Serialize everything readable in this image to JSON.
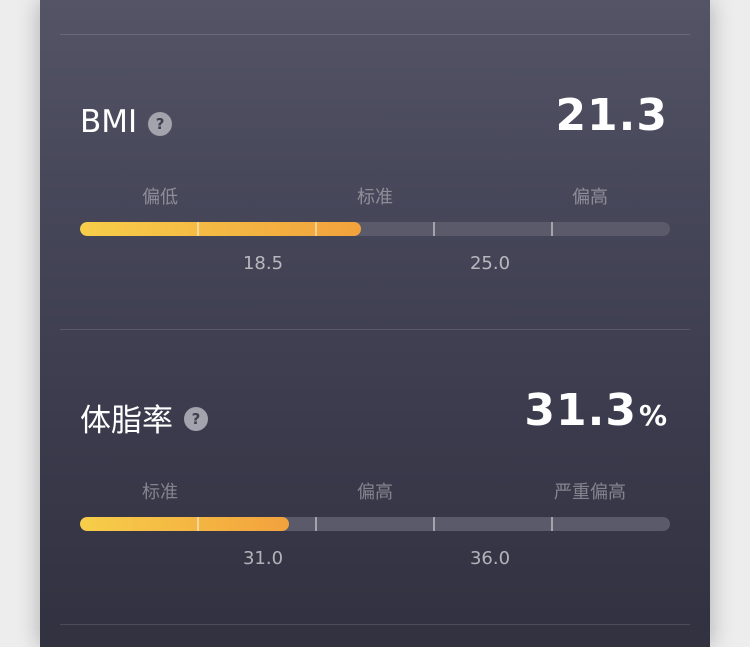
{
  "bmi": {
    "label": "BMI",
    "help_icon": "?",
    "value": "21.3",
    "value_number": 21.3,
    "fill_fraction": 0.477,
    "categories": [
      "偏低",
      "标准",
      "偏高"
    ],
    "thresholds": [
      "18.5",
      "25.0"
    ]
  },
  "body_fat": {
    "label": "体脂率",
    "help_icon": "?",
    "value": "31.3",
    "unit": "%",
    "value_number": 31.3,
    "fill_fraction": 0.355,
    "categories": [
      "标准",
      "偏高",
      "严重偏高"
    ],
    "thresholds": [
      "31.0",
      "36.0"
    ]
  },
  "colors": {
    "bar_start": "#f7ce4a",
    "bar_end": "#f2a23c",
    "track": "#5a5a6b"
  }
}
